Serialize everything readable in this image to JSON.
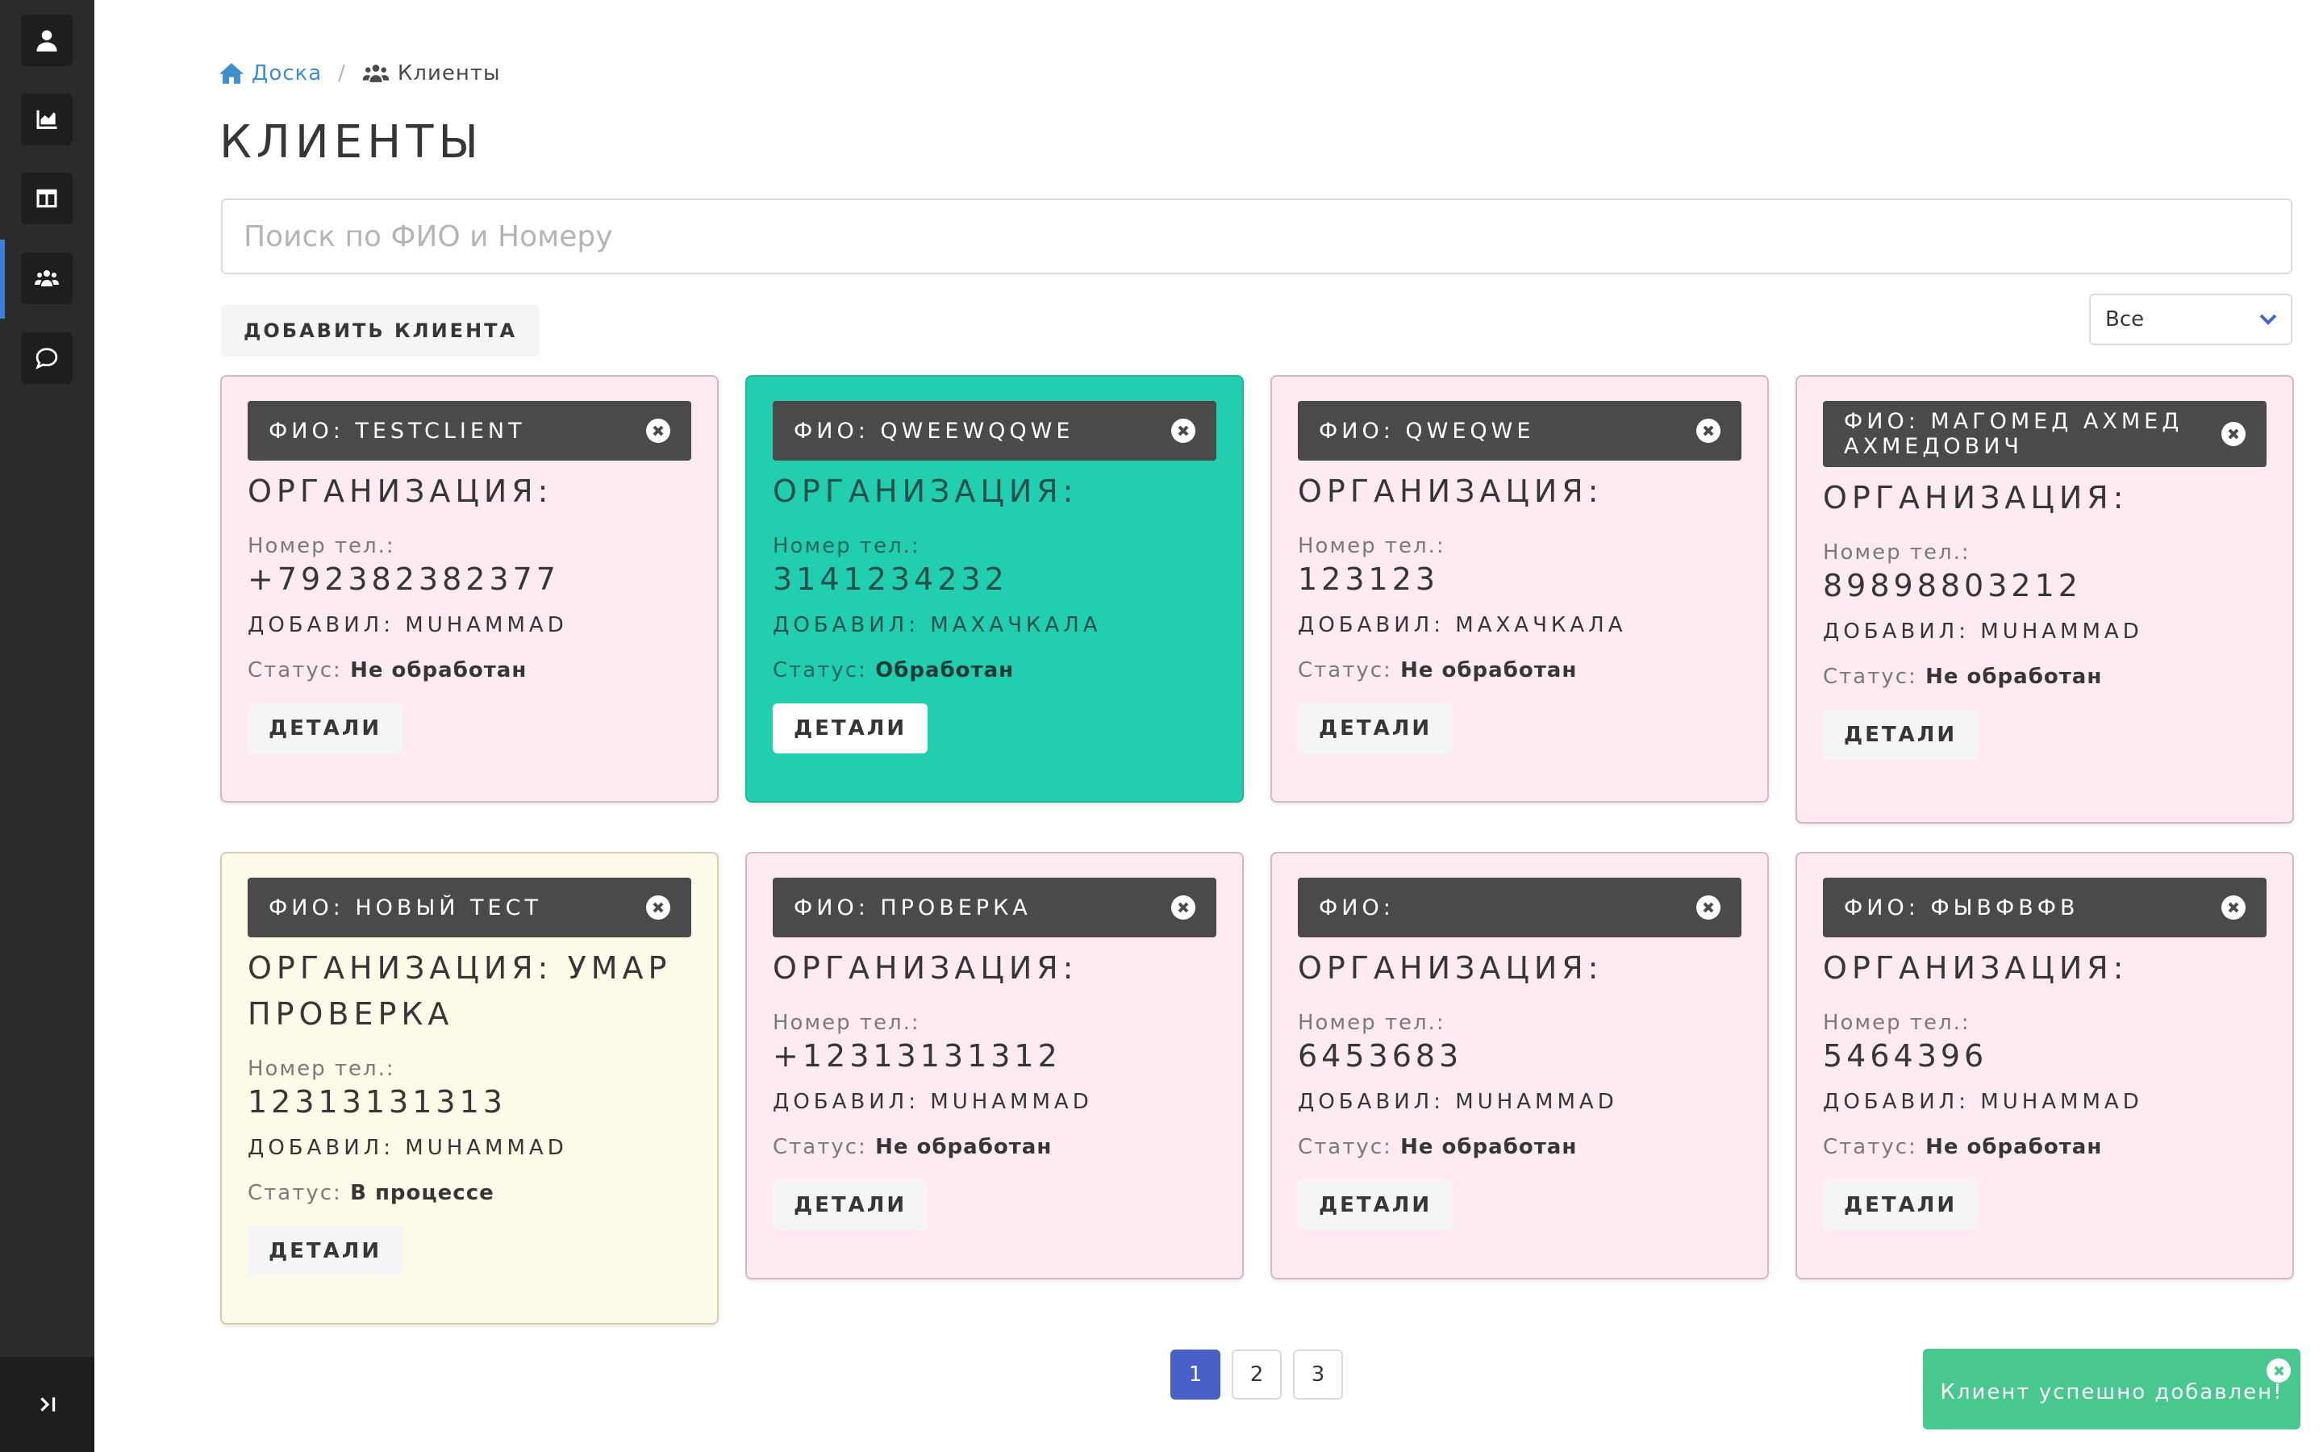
{
  "sidebar": {
    "items": [
      {
        "icon": "user-icon"
      },
      {
        "icon": "chart-icon"
      },
      {
        "icon": "table-icon"
      },
      {
        "icon": "users-icon",
        "active": true
      },
      {
        "icon": "chat-icon"
      }
    ],
    "collapse_icon": "collapse-icon"
  },
  "breadcrumb": {
    "home_label": "Доска",
    "current_label": "Клиенты"
  },
  "page": {
    "title": "Клиенты"
  },
  "search": {
    "placeholder": "Поиск по ФИО и Номеру",
    "value": ""
  },
  "toolbar": {
    "add_label": "Добавить клиента",
    "filter_value": "Все"
  },
  "labels": {
    "fio": "ФИО:",
    "org": "Организация:",
    "phone": "Номер тел.:",
    "added_by": "Добавил:",
    "status": "Статус:",
    "details": "Детали"
  },
  "clients": [
    {
      "fio": "ФИО: testclient",
      "org": "Организация:",
      "phone": "+792382382377",
      "added": "Добавил: Muhammad",
      "status": "Не обработан",
      "color": "pink"
    },
    {
      "fio": "ФИО: qweewqqwe",
      "org": "Организация:",
      "phone": "3141234232",
      "added": "Добавил: Махачкала",
      "status": "Обработан",
      "color": "teal"
    },
    {
      "fio": "ФИО: qweqwe",
      "org": "Организация:",
      "phone": "123123",
      "added": "Добавил: Махачкала",
      "status": "Не обработан",
      "color": "pink"
    },
    {
      "fio": "ФИО: Магомед Ахмед Ахмедович",
      "org": "Организация:",
      "phone": "89898803212",
      "added": "Добавил: Muhammad",
      "status": "Не обработан",
      "color": "pink"
    },
    {
      "fio": "ФИО: Новый тест",
      "org": "Организация: Умар проверка",
      "phone": "12313131313",
      "added": "Добавил: Muhammad",
      "status": "В процессе",
      "color": "cream"
    },
    {
      "fio": "ФИО: проверка",
      "org": "Организация:",
      "phone": "+12313131312",
      "added": "Добавил: Muhammad",
      "status": "Не обработан",
      "color": "pink"
    },
    {
      "fio": "ФИО:",
      "org": "Организация:",
      "phone": "6453683",
      "added": "Добавил: Muhammad",
      "status": "Не обработан",
      "color": "pink"
    },
    {
      "fio": "ФИО: фывфвфв",
      "org": "Организация:",
      "phone": "5464396",
      "added": "Добавил: Muhammad",
      "status": "Не обработан",
      "color": "pink"
    }
  ],
  "pagination": {
    "pages": [
      "1",
      "2",
      "3"
    ],
    "current": "1"
  },
  "toast": {
    "message": "Клиент успешно добавлен!"
  },
  "colors": {
    "accent": "#3e8ed0",
    "sidebar": "#2b2b2b",
    "card_pink": "#feebef",
    "card_teal": "#21ceb0",
    "card_cream": "#fdfaea",
    "toast": "#48c78e",
    "page_current": "#485fc7"
  }
}
